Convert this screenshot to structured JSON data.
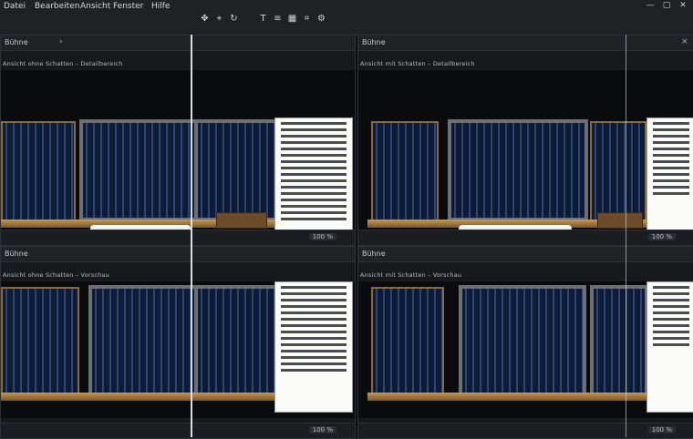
{
  "app": {
    "menu": [
      "Datei",
      "Bearbeiten",
      "Ansicht",
      "Fenster",
      "Hilfe"
    ],
    "win_controls": [
      "—",
      "▢",
      "✕"
    ]
  },
  "toolbar": {
    "tools": [
      "move-icon",
      "select-icon",
      "rotate-icon",
      "text-icon",
      "layers-icon",
      "grid-icon",
      "crop-icon",
      "settings-icon"
    ]
  },
  "panes": [
    {
      "label": "Bühne",
      "caption": "Ansicht ohne Schatten – Detailbereich"
    },
    {
      "label": "Bühne",
      "caption": "Ansicht mit Schatten – Detailbereich"
    },
    {
      "label": "Bühne",
      "caption": "Ansicht ohne Schatten – Vorschau"
    },
    {
      "label": "Bühne",
      "caption": "Ansicht mit Schatten – Vorschau"
    }
  ],
  "footer": {
    "chip": "100 %"
  }
}
